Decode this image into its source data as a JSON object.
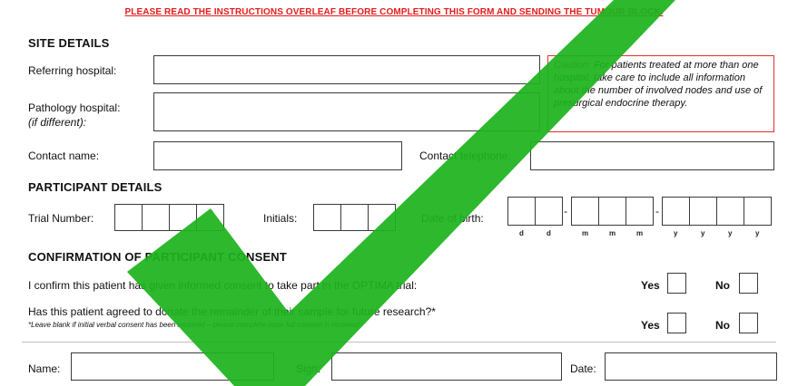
{
  "notice": "PLEASE READ THE INSTRUCTIONS OVERLEAF BEFORE COMPLETING THIS FORM AND SENDING THE TUMOUR BLOCK.",
  "site": {
    "heading": "SITE DETAILS",
    "referring_label": "Referring hospital:",
    "referring_value": "",
    "pathology_label": "Pathology hospital:",
    "pathology_sub": "(if different):",
    "pathology_value": "",
    "caution_lead": "Caution: ",
    "caution_text": "For patients treated at more than one hospital, take care to include all information about the number of involved nodes and use of presurgical endocrine therapy.",
    "contact_name_label": "Contact name:",
    "contact_name_value": "",
    "contact_tel_label": "Contact telephone:",
    "contact_tel_value": ""
  },
  "participant": {
    "heading": "PARTICIPANT DETAILS",
    "trial_label": "Trial Number:",
    "initials_label": "Initials:",
    "dob_label": "Date of birth:",
    "dob_sublabels": [
      "d",
      "d",
      "m",
      "m",
      "m",
      "y",
      "y",
      "y",
      "y"
    ]
  },
  "consent": {
    "heading": "CONFIRMATION OF PARTICIPANT CONSENT",
    "q1": "I confirm this patient has given informed consent to take part in the OPTIMA trial:",
    "q2": "Has this patient agreed to donate the remainder of their sample for future research?*",
    "note": "*Leave blank if initial verbal consent has been received – please complete once full consent is received",
    "yes": "Yes",
    "no": "No"
  },
  "signature": {
    "name_label": "Name:",
    "sign_label": "Sign:",
    "date_label": "Date:"
  },
  "colors": {
    "notice": "#e21b1b",
    "caution_border": "#e03131",
    "check": "#1db31d"
  }
}
